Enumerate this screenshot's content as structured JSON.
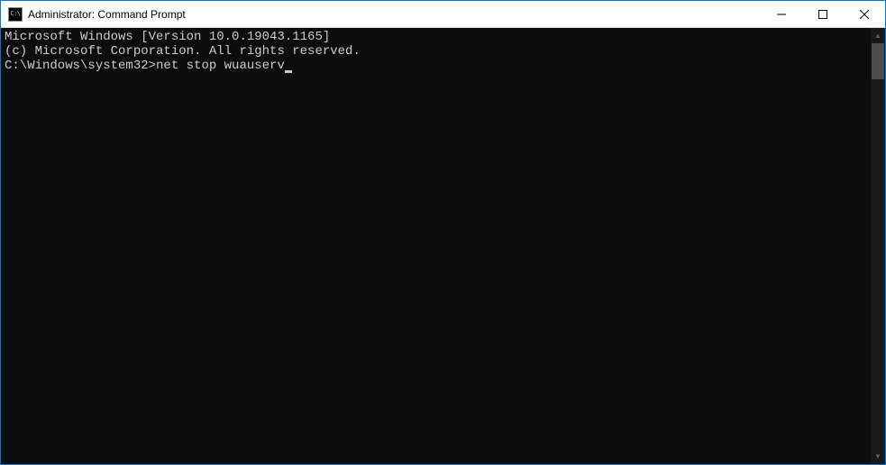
{
  "window": {
    "title": "Administrator: Command Prompt",
    "icon_label": "C:\\"
  },
  "terminal": {
    "line1": "Microsoft Windows [Version 10.0.19043.1165]",
    "line2": "(c) Microsoft Corporation. All rights reserved.",
    "blank": "",
    "prompt": "C:\\Windows\\system32>",
    "command": "net stop wuauserv"
  }
}
